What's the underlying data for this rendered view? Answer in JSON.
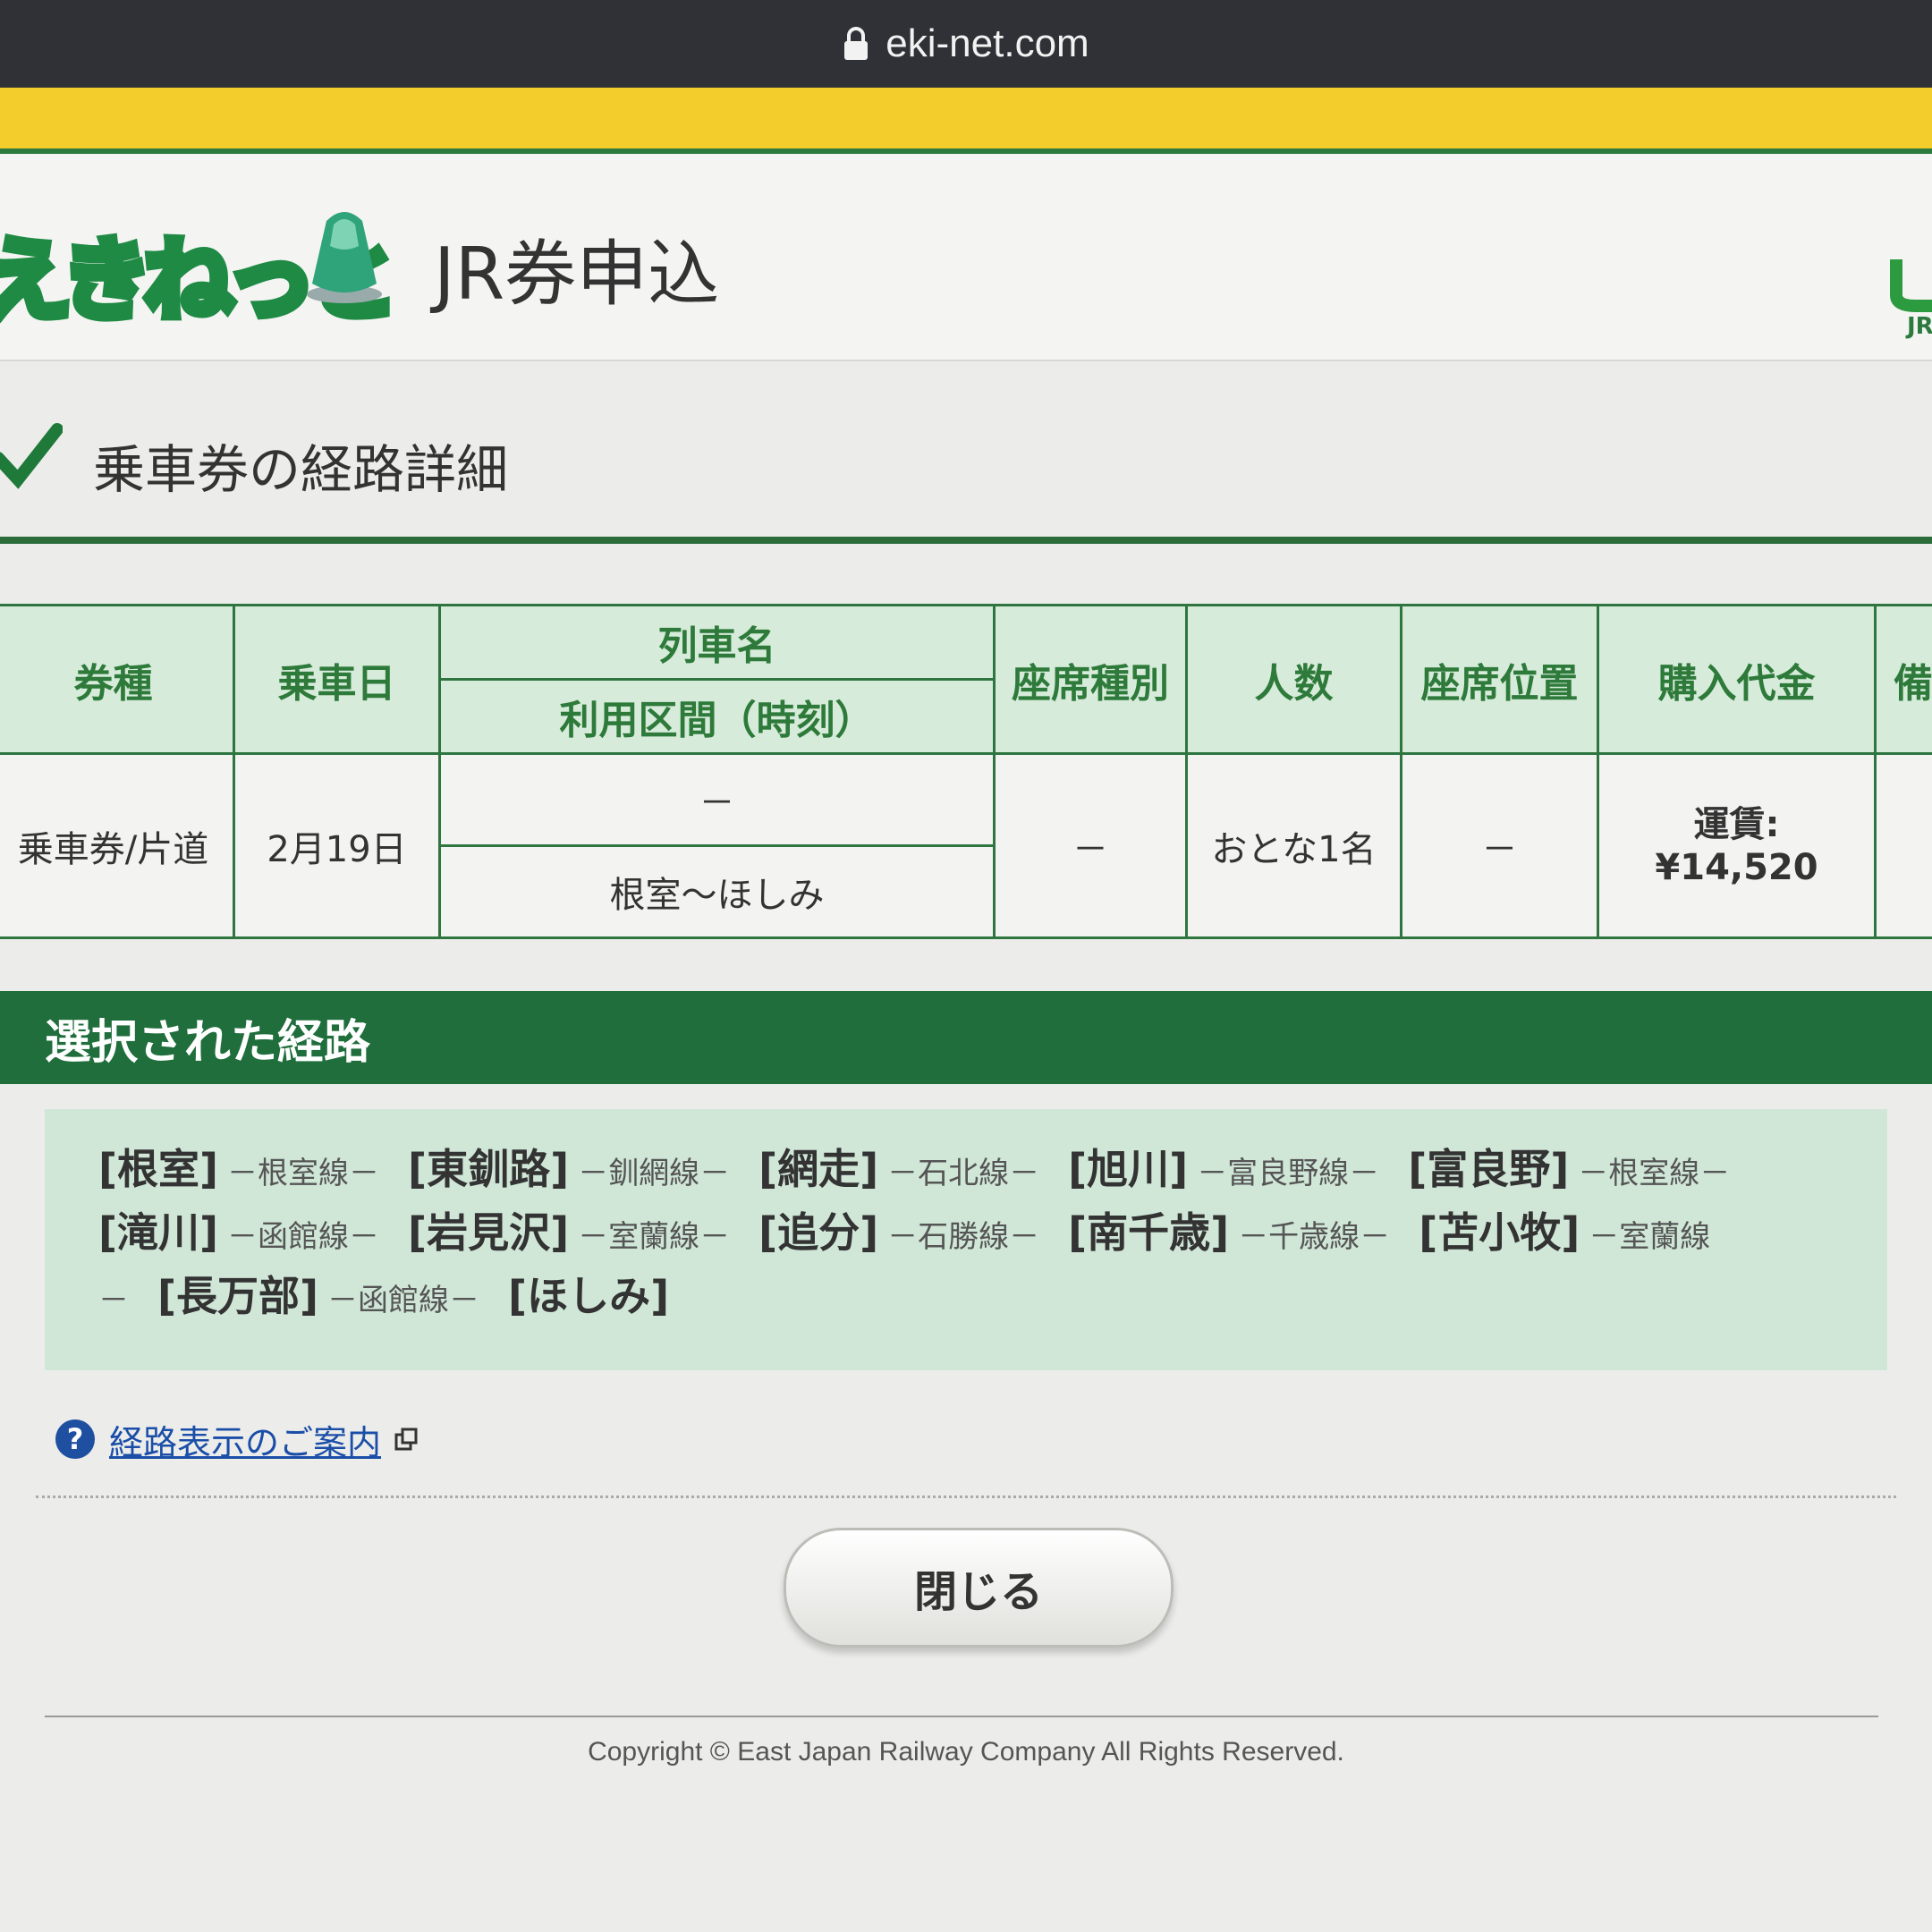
{
  "browser": {
    "url": "eki-net.com"
  },
  "header": {
    "logo_text": "えきねっと",
    "title": "JR券申込",
    "jr_logo_text": "JR"
  },
  "section": {
    "title": "乗車券の経路詳細"
  },
  "table": {
    "headers": {
      "ticket_type": "券種",
      "date": "乗車日",
      "train_name": "列車名",
      "section_time": "利用区間（時刻）",
      "seat_type": "座席種別",
      "people": "人数",
      "seat_position": "座席位置",
      "price": "購入代金",
      "remarks": "備"
    },
    "row": {
      "ticket_type": "乗車券/片道",
      "date": "2月19日",
      "train_name": "－",
      "section": "根室～ほしみ",
      "seat_type": "－",
      "people": "おとな1名",
      "seat_position": "－",
      "price_label": "運賃:",
      "price_value": "¥14,520"
    }
  },
  "route": {
    "banner": "選択された経路",
    "stations": [
      "[根室]",
      "[東釧路]",
      "[網走]",
      "[旭川]",
      "[富良野]",
      "[滝川]",
      "[岩見沢]",
      "[追分]",
      "[南千歳]",
      "[苫小牧]",
      "[長万部]",
      "[ほしみ]"
    ],
    "lines": [
      "－根室線－",
      "－釧網線－",
      "－石北線－",
      "－富良野線－",
      "－根室線－",
      "－函館線－",
      "－室蘭線－",
      "－石勝線－",
      "－千歳線－",
      "－室蘭線",
      "－",
      "－函館線－"
    ]
  },
  "help": {
    "link": "経路表示のご案内"
  },
  "close_button": "閉じる",
  "footer": {
    "copyright": "Copyright © East Japan Railway Company All Rights Reserved."
  },
  "colors": {
    "brand_green": "#1f6e3c",
    "header_yellow": "#f2cd2b",
    "table_header_bg": "#d6ebda",
    "route_bg": "#d0e7d8"
  }
}
